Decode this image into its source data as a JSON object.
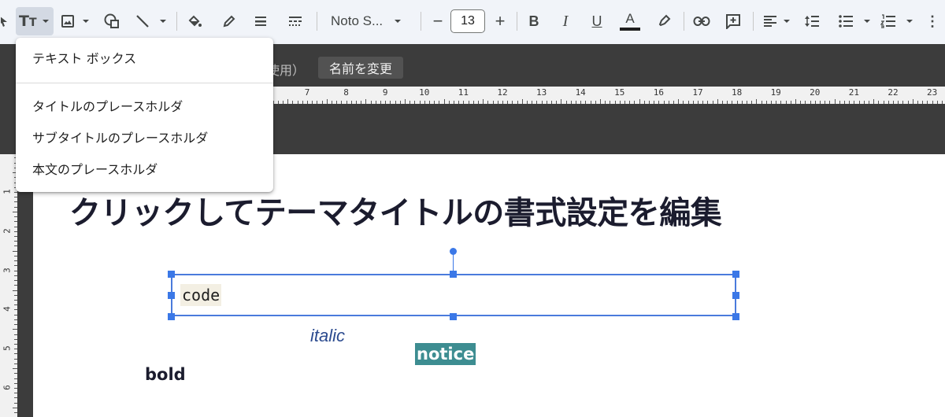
{
  "toolbar": {
    "font_name": "Noto S...",
    "font_size": "13",
    "minus": "−",
    "plus": "+",
    "bold": "B",
    "italic": "I",
    "underline": "U",
    "text_color": "A",
    "text_tool": "Tт",
    "more": "⋮"
  },
  "header": {
    "layout_hint_fragment": "使用）",
    "rename_button": "名前を変更"
  },
  "ruler": {
    "h_numbers": [
      "7",
      "8",
      "9",
      "10",
      "11",
      "12",
      "13",
      "14",
      "15",
      "16",
      "17",
      "18",
      "19",
      "20",
      "21",
      "22",
      "23"
    ],
    "v_numbers": [
      "1",
      "2",
      "3",
      "4",
      "5",
      "6"
    ]
  },
  "menu": {
    "items": [
      "テキスト ボックス",
      "タイトルのプレースホルダ",
      "サブタイトルのプレースホルダ",
      "本文のプレースホルダ"
    ]
  },
  "slide": {
    "title": "クリックしてテーマタイトルの書式設定を編集",
    "code": "code",
    "italic": "italic",
    "notice": "notice",
    "bold": "bold"
  },
  "colors": {
    "selection": "#3b78e7",
    "notice_bg": "#3d8d91",
    "italic_text": "#2c4b8f",
    "code_bg": "#f3efe3"
  }
}
